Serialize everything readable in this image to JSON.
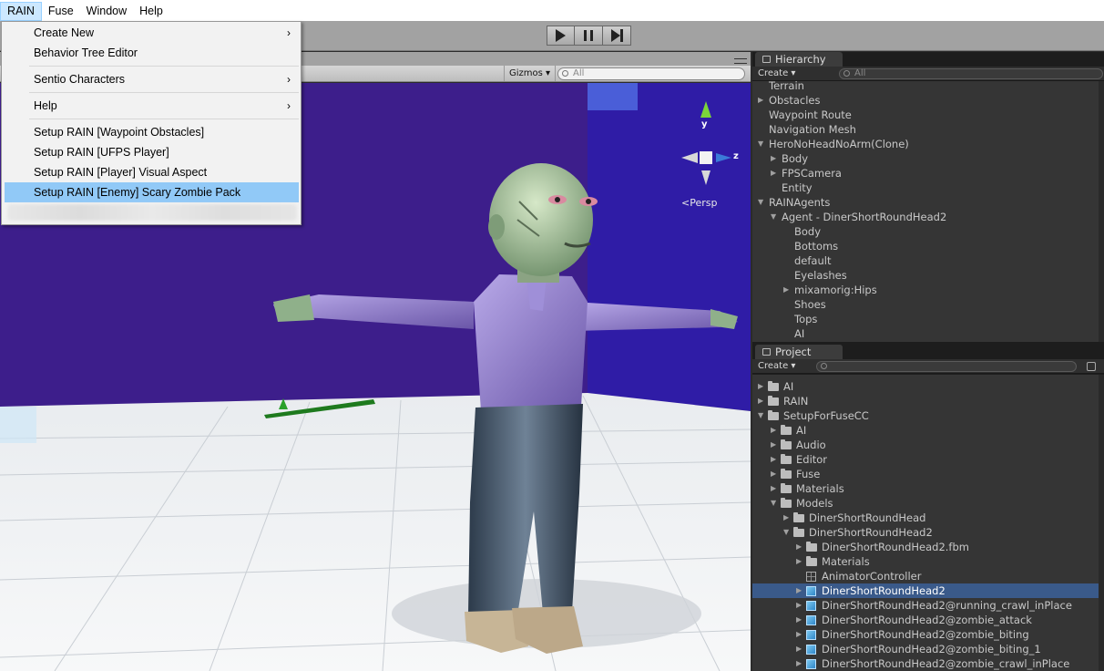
{
  "menubar": {
    "items": [
      "RAIN",
      "Fuse",
      "Window",
      "Help"
    ]
  },
  "dropdown": {
    "items": [
      {
        "label": "Create New",
        "submenu": true
      },
      {
        "label": "Behavior Tree Editor",
        "submenu": false
      },
      {
        "label": "Sentio Characters",
        "submenu": true
      },
      {
        "label": "Help",
        "submenu": true
      },
      {
        "label": "Setup RAIN [Waypoint Obstacles]",
        "submenu": false
      },
      {
        "label": "Setup RAIN [UFPS Player]",
        "submenu": false
      },
      {
        "label": "Setup RAIN [Player] Visual Aspect",
        "submenu": false
      },
      {
        "label": "Setup RAIN [Enemy] Scary Zombie Pack",
        "submenu": false,
        "highlighted": true
      }
    ],
    "submenu_arrow": "›"
  },
  "scene": {
    "gizmos_label": "Gizmos ▾",
    "search_placeholder": "All",
    "persp_label": "<Persp",
    "axis_y": "y",
    "axis_z": "z"
  },
  "hierarchy": {
    "tab": "Hierarchy",
    "create": "Create ▾",
    "search_placeholder": "All",
    "rows": [
      "Terrain",
      "Obstacles",
      "Waypoint Route",
      "Navigation Mesh",
      "HeroNoHeadNoArm(Clone)",
      "Body",
      "FPSCamera",
      "Entity",
      "RAINAgents",
      "Agent - DinerShortRoundHead2",
      "Body",
      "Bottoms",
      "default",
      "Eyelashes",
      "mixamorig:Hips",
      "Shoes",
      "Tops",
      "AI"
    ]
  },
  "project": {
    "tab": "Project",
    "create": "Create ▾",
    "rows": [
      "AI",
      "RAIN",
      "SetupForFuseCC",
      "AI",
      "Audio",
      "Editor",
      "Fuse",
      "Materials",
      "Models",
      "DinerShortRoundHead",
      "DinerShortRoundHead2",
      "DinerShortRoundHead2.fbm",
      "Materials",
      "AnimatorController",
      "DinerShortRoundHead2",
      "DinerShortRoundHead2@running_crawl_inPlace",
      "DinerShortRoundHead2@zombie_attack",
      "DinerShortRoundHead2@zombie_biting",
      "DinerShortRoundHead2@zombie_biting_1",
      "DinerShortRoundHead2@zombie_crawl_inPlace"
    ]
  },
  "colors": {
    "menu_highlight": "#91c9f7",
    "scene_wall": "#3e1e8c",
    "selection": "#3a5a8a"
  }
}
